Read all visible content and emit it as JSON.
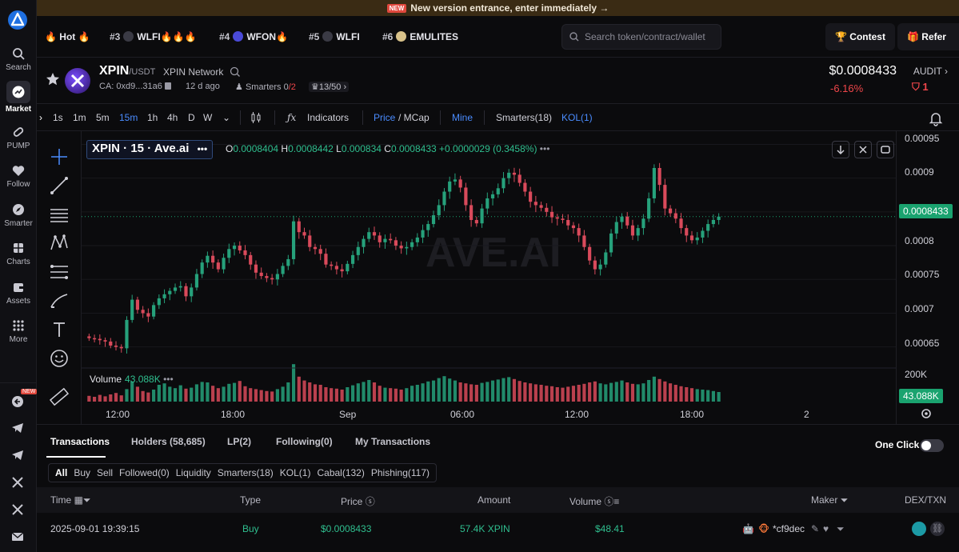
{
  "banner": {
    "badge": "NEW",
    "text": "New version entrance, enter immediately →"
  },
  "sidebar": {
    "items": [
      {
        "label": "Search",
        "icon": "search-icon"
      },
      {
        "label": "Market",
        "icon": "market-icon",
        "active": true
      },
      {
        "label": "PUMP",
        "icon": "pill-icon"
      },
      {
        "label": "Follow",
        "icon": "heart-icon"
      },
      {
        "label": "Smarter",
        "icon": "compass-icon"
      },
      {
        "label": "Charts",
        "icon": "charts-icon"
      },
      {
        "label": "Assets",
        "icon": "wallet-icon"
      },
      {
        "label": "More",
        "icon": "grid-icon"
      }
    ],
    "new_badge": "NEW"
  },
  "hotbar": {
    "hot_label": "Hot",
    "items": [
      {
        "rank": "#3",
        "name": "WLFI"
      },
      {
        "rank": "#4",
        "name": "WFON"
      },
      {
        "rank": "#5",
        "name": "WLFI"
      },
      {
        "rank": "#6",
        "name": "EMULITES"
      }
    ],
    "search_placeholder": "Search token/contract/wallet",
    "contest": "Contest",
    "refer": "Refer"
  },
  "token": {
    "symbol": "XPIN",
    "pair": "/USDT",
    "network": "XPIN Network",
    "ca": "CA: 0xd9...31a6",
    "age": "12 d ago",
    "smarters_label": "Smarters",
    "smarters_a": "0",
    "smarters_b": "/2",
    "holders_ratio": "13/50",
    "price": "$0.0008433",
    "change": "-6.16%",
    "audit": "AUDIT",
    "audit_count": "1"
  },
  "chart_toolbar": {
    "intervals": [
      "1s",
      "1m",
      "5m",
      "15m",
      "1h",
      "4h",
      "D",
      "W"
    ],
    "selected_interval": "15m",
    "indicators": "Indicators",
    "price": "Price",
    "mcap": "/ MCap",
    "mine": "Mine",
    "smarters": "Smarters(18)",
    "kol": "KOL(1)"
  },
  "chart": {
    "legend": "XPIN · 15 · Ave.ai",
    "o": "0.0008404",
    "h": "0.0008442",
    "l": "0.000834",
    "c": "0.0008433",
    "delta": "+0.0000029 (0.3458%)",
    "volume_label": "Volume",
    "volume_value": "43.088K",
    "watermark": "AVE.AI",
    "current_price_label": "0.0008433",
    "current_volume_label": "43.088K",
    "volume_axis_label": "200K",
    "bull_color": "#26a17b",
    "bear_color": "#d94a5b"
  },
  "chart_data": {
    "type": "candlestick",
    "x_ticks": [
      "12:00",
      "18:00",
      "Sep",
      "06:00",
      "12:00",
      "18:00",
      "2"
    ],
    "y_ticks": [
      0.00095,
      0.0009,
      0.00085,
      0.0008,
      0.00075,
      0.0007,
      0.00065
    ],
    "ylim": [
      0.00062,
      0.00096
    ],
    "close": [
      0.000663,
      0.000662,
      0.00066,
      0.000658,
      0.000652,
      0.00065,
      0.000648,
      0.00069,
      0.00072,
      0.000705,
      0.0007,
      0.000695,
      0.000712,
      0.000722,
      0.000728,
      0.000733,
      0.000738,
      0.00074,
      0.000725,
      0.000738,
      0.000758,
      0.000775,
      0.000785,
      0.000775,
      0.000765,
      0.000782,
      0.000795,
      0.0008,
      0.000793,
      0.000786,
      0.000772,
      0.00076,
      0.000755,
      0.000752,
      0.00075,
      0.000758,
      0.00077,
      0.00078,
      0.000836,
      0.00082,
      0.000815,
      0.000798,
      0.000795,
      0.000788,
      0.000772,
      0.00077,
      0.000765,
      0.000762,
      0.000773,
      0.000786,
      0.000798,
      0.00081,
      0.00082,
      0.000815,
      0.000805,
      0.00081,
      0.000808,
      0.0008,
      0.000796,
      0.000798,
      0.000805,
      0.000812,
      0.000823,
      0.000832,
      0.000845,
      0.00086,
      0.00088,
      0.000895,
      0.000898,
      0.000886,
      0.00086,
      0.000838,
      0.000833,
      0.000855,
      0.00087,
      0.000876,
      0.000885,
      0.0009,
      0.000908,
      0.000905,
      0.000893,
      0.00088,
      0.000865,
      0.00086,
      0.000856,
      0.00085,
      0.000842,
      0.00084,
      0.000838,
      0.00083,
      0.000826,
      0.000815,
      0.000798,
      0.000778,
      0.000765,
      0.000772,
      0.00079,
      0.000818,
      0.000835,
      0.000843,
      0.00083,
      0.000815,
      0.000826,
      0.00084,
      0.00087,
      0.000915,
      0.00089,
      0.000855,
      0.000848,
      0.00084,
      0.000826,
      0.000815,
      0.000808,
      0.000812,
      0.000822,
      0.000832,
      0.000838,
      0.000843
    ],
    "volume": [
      0.12,
      0.1,
      0.14,
      0.11,
      0.15,
      0.18,
      0.13,
      0.26,
      0.42,
      0.31,
      0.22,
      0.19,
      0.25,
      0.35,
      0.38,
      0.31,
      0.28,
      0.34,
      0.27,
      0.29,
      0.36,
      0.41,
      0.4,
      0.33,
      0.28,
      0.31,
      0.37,
      0.39,
      0.43,
      0.32,
      0.28,
      0.26,
      0.24,
      0.22,
      0.21,
      0.26,
      0.31,
      0.4,
      0.78,
      0.52,
      0.44,
      0.4,
      0.36,
      0.35,
      0.3,
      0.28,
      0.27,
      0.25,
      0.3,
      0.34,
      0.38,
      0.41,
      0.45,
      0.4,
      0.33,
      0.29,
      0.28,
      0.27,
      0.25,
      0.28,
      0.33,
      0.35,
      0.38,
      0.42,
      0.44,
      0.49,
      0.53,
      0.48,
      0.44,
      0.4,
      0.38,
      0.36,
      0.35,
      0.39,
      0.41,
      0.44,
      0.46,
      0.49,
      0.51,
      0.47,
      0.43,
      0.4,
      0.38,
      0.36,
      0.35,
      0.33,
      0.32,
      0.3,
      0.29,
      0.31,
      0.33,
      0.35,
      0.37,
      0.4,
      0.42,
      0.38,
      0.36,
      0.39,
      0.41,
      0.44,
      0.4,
      0.37,
      0.36,
      0.38,
      0.45,
      0.52,
      0.47,
      0.42,
      0.38,
      0.35,
      0.32,
      0.3,
      0.28,
      0.26,
      0.25,
      0.24,
      0.22,
      0.2
    ]
  },
  "transactions": {
    "tabs": [
      "Transactions",
      "Holders (58,685)",
      "LP(2)",
      "Following(0)",
      "My Transactions"
    ],
    "one_click": "One Click",
    "filters": [
      "All",
      "Buy",
      "Sell",
      "Followed(0)",
      "Liquidity",
      "Smarters(18)",
      "KOL(1)",
      "Cabal(132)",
      "Phishing(117)"
    ],
    "columns": [
      "Time",
      "Type",
      "Price",
      "Amount",
      "Volume",
      "Maker",
      "DEX/TXN"
    ],
    "rows": [
      {
        "time": "2025-09-01 19:39:15",
        "type": "Buy",
        "price": "$0.0008433",
        "amount": "57.4K XPIN",
        "volume": "$48.41",
        "maker": "*cf9dec"
      }
    ]
  }
}
